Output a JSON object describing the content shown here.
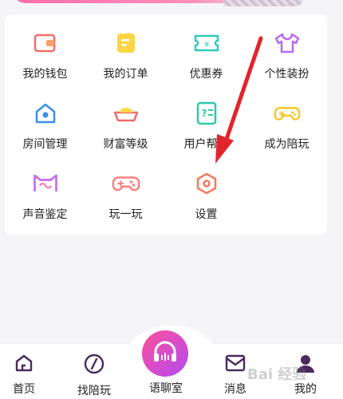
{
  "grid": [
    {
      "label": "我的钱包",
      "icon": "wallet-icon"
    },
    {
      "label": "我的订单",
      "icon": "order-icon"
    },
    {
      "label": "优惠券",
      "icon": "coupon-icon"
    },
    {
      "label": "个性装扮",
      "icon": "tshirt-icon"
    },
    {
      "label": "房间管理",
      "icon": "house-icon"
    },
    {
      "label": "财富等级",
      "icon": "ingot-icon"
    },
    {
      "label": "用户帮助",
      "icon": "help-doc-icon"
    },
    {
      "label": "成为陪玩",
      "icon": "gamepad-icon"
    },
    {
      "label": "声音鉴定",
      "icon": "sound-cat-icon"
    },
    {
      "label": "玩一玩",
      "icon": "game-controller-icon"
    },
    {
      "label": "设置",
      "icon": "settings-hexagon-icon"
    }
  ],
  "tabs": {
    "home": "首页",
    "find": "找陪玩",
    "chat": "语聊室",
    "messages": "消息",
    "mine": "我的"
  },
  "watermark": "Bai 经验",
  "colors": {
    "accent_pink": "#ff4f9a",
    "accent_purple": "#b24bf3",
    "arrow_red": "#e3242b",
    "tab_icon": "#4a2a5e"
  }
}
